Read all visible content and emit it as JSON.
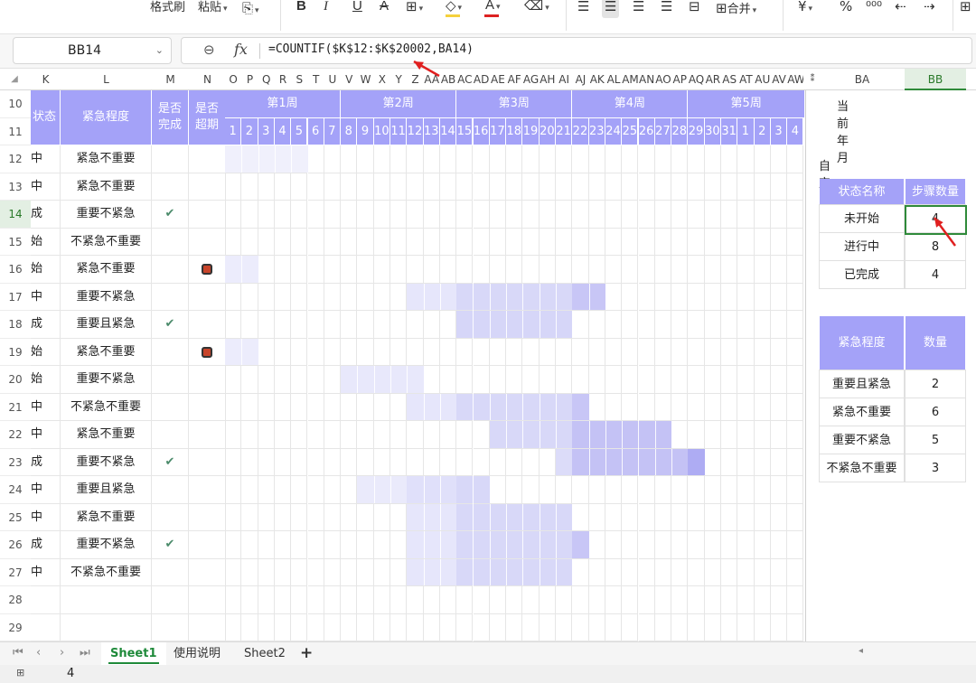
{
  "ribbon": {
    "format_painter": "格式刷",
    "paste": "粘贴",
    "bold": "B",
    "italic": "I",
    "underline": "U",
    "strike": "A",
    "merge": "合并",
    "currency": "¥",
    "percent": "%"
  },
  "formula_bar": {
    "name_box": "BB14",
    "fx": "fx",
    "formula": "=COUNTIF($K$12:$K$20002,BA14)"
  },
  "columns": [
    {
      "label": "K",
      "active": false
    },
    {
      "label": "L",
      "active": false
    },
    {
      "label": "M",
      "active": false
    },
    {
      "label": "N",
      "active": false
    },
    {
      "label": "O",
      "active": false
    },
    {
      "label": "P",
      "active": false
    },
    {
      "label": "Q",
      "active": false
    },
    {
      "label": "R",
      "active": false
    },
    {
      "label": "S",
      "active": false
    },
    {
      "label": "T",
      "active": false
    },
    {
      "label": "U",
      "active": false
    },
    {
      "label": "V",
      "active": false
    },
    {
      "label": "W",
      "active": false
    },
    {
      "label": "X",
      "active": false
    },
    {
      "label": "Y",
      "active": false
    },
    {
      "label": "Z",
      "active": false
    },
    {
      "label": "AA",
      "active": false
    },
    {
      "label": "AB",
      "active": false
    },
    {
      "label": "AC",
      "active": false
    },
    {
      "label": "AD",
      "active": false
    },
    {
      "label": "AE",
      "active": false
    },
    {
      "label": "AF",
      "active": false
    },
    {
      "label": "AG",
      "active": false
    },
    {
      "label": "AH",
      "active": false
    },
    {
      "label": "AI",
      "active": false
    },
    {
      "label": "AJ",
      "active": false
    },
    {
      "label": "AK",
      "active": false
    },
    {
      "label": "AL",
      "active": false
    },
    {
      "label": "AM",
      "active": false
    },
    {
      "label": "AN",
      "active": false
    },
    {
      "label": "AO",
      "active": false
    },
    {
      "label": "AP",
      "active": false
    },
    {
      "label": "AQ",
      "active": false
    },
    {
      "label": "AR",
      "active": false
    },
    {
      "label": "AS",
      "active": false
    },
    {
      "label": "AT",
      "active": false
    },
    {
      "label": "AU",
      "active": false
    },
    {
      "label": "AV",
      "active": false
    },
    {
      "label": "AW",
      "active": false
    },
    {
      "label": "BA",
      "active": false
    },
    {
      "label": "BB",
      "active": true
    }
  ],
  "row_numbers": [
    "10",
    "11",
    "12",
    "13",
    "14",
    "15",
    "16",
    "17",
    "18",
    "19",
    "20",
    "21",
    "22",
    "23",
    "24",
    "25",
    "26",
    "27",
    "28",
    "29"
  ],
  "active_row": "14",
  "headers": {
    "status": "状态",
    "urgency": "紧急程度",
    "done": "是否完成",
    "overdue": "是否超期",
    "weeks": [
      "第1周",
      "第2周",
      "第3周",
      "第4周",
      "第5周"
    ],
    "days": [
      "1",
      "2",
      "3",
      "4",
      "5",
      "6",
      "7",
      "8",
      "9",
      "10",
      "11",
      "12",
      "13",
      "14",
      "15",
      "16",
      "17",
      "18",
      "19",
      "20",
      "21",
      "22",
      "23",
      "24",
      "25",
      "26",
      "27",
      "28",
      "29",
      "30",
      "31",
      "1",
      "2",
      "3",
      "4"
    ]
  },
  "tasks": [
    {
      "status": "中",
      "urgency": "紧急不重要",
      "done": "",
      "overdue": "",
      "bars": [
        [
          0,
          5,
          "#f0f0fc"
        ]
      ]
    },
    {
      "status": "中",
      "urgency": "紧急不重要",
      "done": "",
      "overdue": "",
      "bars": []
    },
    {
      "status": "成",
      "urgency": "重要不紧急",
      "done": "✔",
      "overdue": "",
      "bars": []
    },
    {
      "status": "始",
      "urgency": "不紧急不重要",
      "done": "",
      "overdue": "",
      "bars": []
    },
    {
      "status": "始",
      "urgency": "紧急不重要",
      "done": "",
      "overdue": "■",
      "bars": [
        [
          0,
          2,
          "#ececfc"
        ]
      ]
    },
    {
      "status": "中",
      "urgency": "重要不紧急",
      "done": "",
      "overdue": "",
      "bars": [
        [
          11,
          3,
          "#e6e6fb"
        ],
        [
          14,
          7,
          "#d8d8f8"
        ],
        [
          21,
          2,
          "#c8c6f6"
        ]
      ]
    },
    {
      "status": "成",
      "urgency": "重要且紧急",
      "done": "✔",
      "overdue": "",
      "bars": [
        [
          14,
          7,
          "#d6d6f8"
        ]
      ]
    },
    {
      "status": "始",
      "urgency": "紧急不重要",
      "done": "",
      "overdue": "■",
      "bars": [
        [
          0,
          2,
          "#ececfc"
        ]
      ]
    },
    {
      "status": "始",
      "urgency": "重要不紧急",
      "done": "",
      "overdue": "",
      "bars": [
        [
          7,
          5,
          "#e8e8fb"
        ]
      ]
    },
    {
      "status": "中",
      "urgency": "不紧急不重要",
      "done": "",
      "overdue": "",
      "bars": [
        [
          11,
          3,
          "#e6e6fb"
        ],
        [
          14,
          7,
          "#d8d8f8"
        ],
        [
          21,
          1,
          "#c8c6f6"
        ]
      ]
    },
    {
      "status": "中",
      "urgency": "紧急不重要",
      "done": "",
      "overdue": "",
      "bars": [
        [
          16,
          5,
          "#d8d8f8"
        ],
        [
          21,
          6,
          "#c4c2f5"
        ]
      ]
    },
    {
      "status": "成",
      "urgency": "重要不紧急",
      "done": "✔",
      "overdue": "",
      "bars": [
        [
          20,
          1,
          "#dcdcf9"
        ],
        [
          21,
          7,
          "#c4c2f5"
        ],
        [
          28,
          1,
          "#aeacf3"
        ]
      ]
    },
    {
      "status": "中",
      "urgency": "重要且紧急",
      "done": "",
      "overdue": "",
      "bars": [
        [
          8,
          3,
          "#eaeafb"
        ],
        [
          11,
          3,
          "#e0e0fa"
        ],
        [
          14,
          2,
          "#d8d8f8"
        ]
      ]
    },
    {
      "status": "中",
      "urgency": "紧急不重要",
      "done": "",
      "overdue": "",
      "bars": [
        [
          11,
          3,
          "#e6e6fb"
        ],
        [
          14,
          7,
          "#d8d8f8"
        ]
      ]
    },
    {
      "status": "成",
      "urgency": "重要不紧急",
      "done": "✔",
      "overdue": "",
      "bars": [
        [
          11,
          3,
          "#e6e6fb"
        ],
        [
          14,
          7,
          "#d8d8f8"
        ],
        [
          21,
          1,
          "#c8c6f6"
        ]
      ]
    },
    {
      "status": "中",
      "urgency": "不紧急不重要",
      "done": "",
      "overdue": "",
      "bars": [
        [
          11,
          3,
          "#e6e6fb"
        ],
        [
          14,
          7,
          "#d8d8f8"
        ]
      ]
    }
  ],
  "right_panel": {
    "current_month_label": "当前年月",
    "custom_status_label": "自定义当前状态",
    "status_table": {
      "headers": [
        "状态名称",
        "步骤数量"
      ],
      "rows": [
        [
          "未开始",
          "4"
        ],
        [
          "进行中",
          "8"
        ],
        [
          "已完成",
          "4"
        ]
      ]
    },
    "urgency_table": {
      "headers": [
        "紧急程度",
        "数量"
      ],
      "rows": [
        [
          "重要且紧急",
          "2"
        ],
        [
          "紧急不重要",
          "6"
        ],
        [
          "重要不紧急",
          "5"
        ],
        [
          "不紧急不重要",
          "3"
        ]
      ]
    }
  },
  "sheet_tabs": [
    "Sheet1",
    "使用说明",
    "Sheet2"
  ],
  "active_tab": "Sheet1",
  "status_bar": {
    "value": "4"
  },
  "colors": {
    "header_purple": "#a4a2f8",
    "select_green": "#2f8a3a",
    "check_green": "#4a8a6a",
    "overdue_red": "#c8442a",
    "arrow_red": "#e02020"
  }
}
